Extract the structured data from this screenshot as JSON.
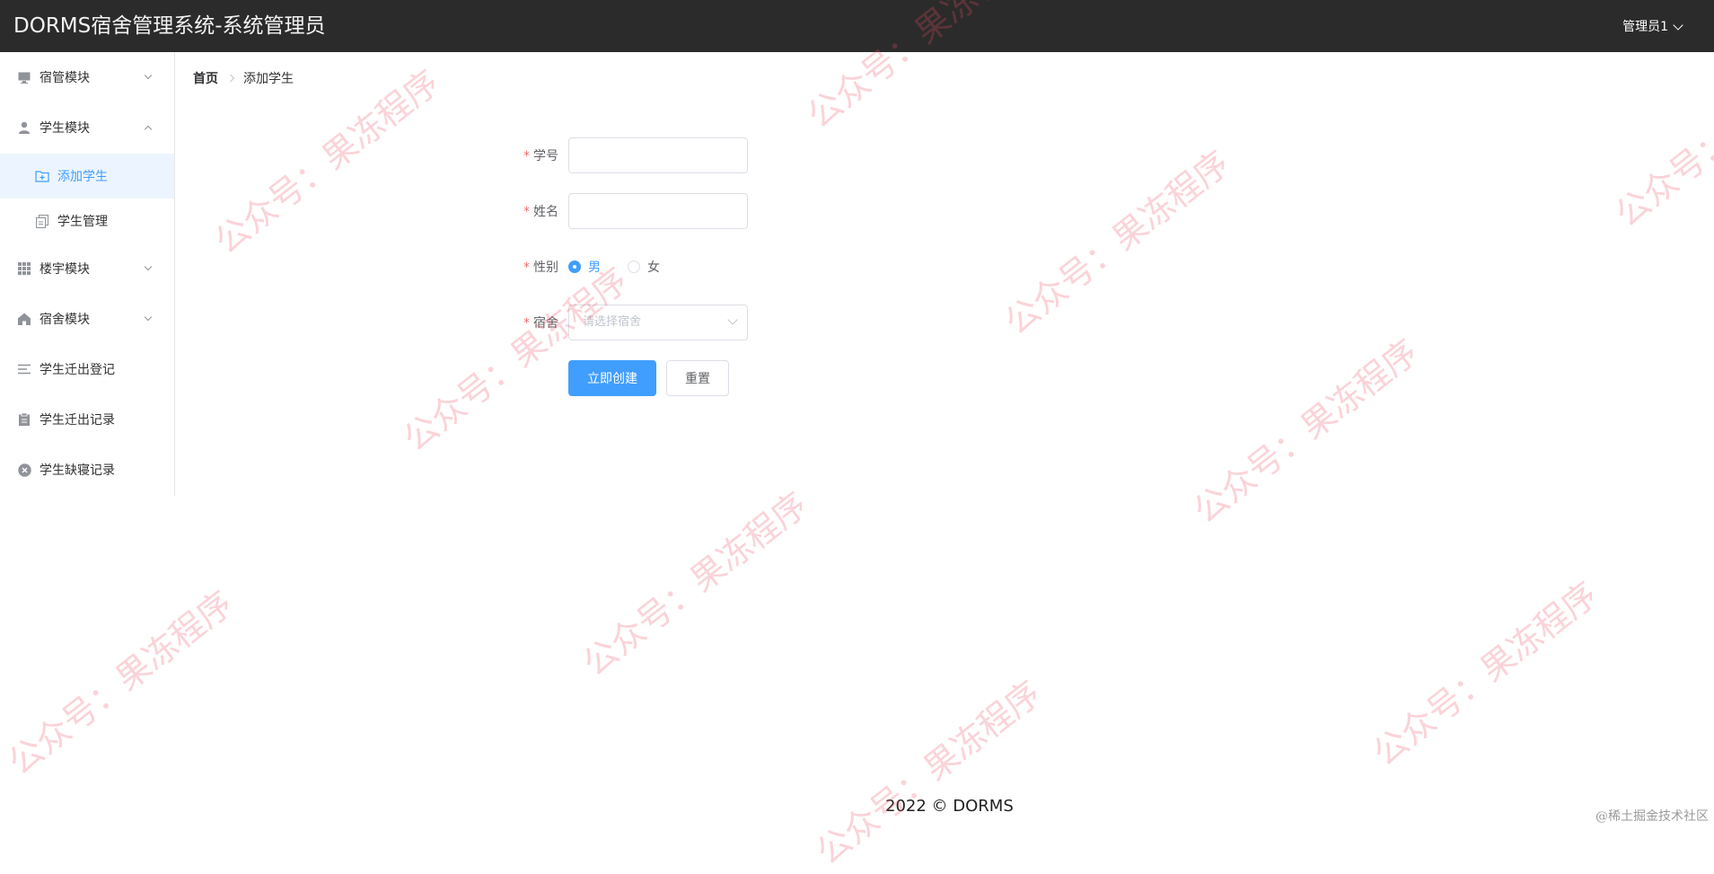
{
  "header": {
    "app_title": "DORMS宿舍管理系统-系统管理员",
    "user_name": "管理员1"
  },
  "sidebar": {
    "items": [
      {
        "label": "宿管模块",
        "icon": "monitor-icon",
        "expanded": false
      },
      {
        "label": "学生模块",
        "icon": "user-icon",
        "expanded": true,
        "children": [
          {
            "label": "添加学生",
            "icon": "folder-add-icon",
            "active": true
          },
          {
            "label": "学生管理",
            "icon": "document-copy-icon",
            "active": false
          }
        ]
      },
      {
        "label": "楼宇模块",
        "icon": "grid-icon",
        "expanded": false
      },
      {
        "label": "宿舍模块",
        "icon": "house-icon",
        "expanded": false
      },
      {
        "label": "学生迁出登记",
        "icon": "list-icon"
      },
      {
        "label": "学生迁出记录",
        "icon": "clipboard-icon"
      },
      {
        "label": "学生缺寝记录",
        "icon": "circle-close-icon"
      }
    ]
  },
  "breadcrumb": {
    "home": "首页",
    "current": "添加学生"
  },
  "form": {
    "required_mark": "*",
    "student_id": {
      "label": "学号",
      "value": ""
    },
    "name": {
      "label": "姓名",
      "value": ""
    },
    "gender": {
      "label": "性别",
      "options": [
        "男",
        "女"
      ],
      "selected": "男"
    },
    "dorm": {
      "label": "宿舍",
      "placeholder": "请选择宿舍"
    },
    "submit_label": "立即创建",
    "reset_label": "重置"
  },
  "footer": {
    "text": "2022 © DORMS"
  },
  "watermark": {
    "text": "公众号：果冻程序",
    "corner_text": "@稀土掘金技术社区"
  },
  "colors": {
    "header_bg": "#2b2b2b",
    "accent": "#409eff",
    "active_bg": "#ecf5ff",
    "required": "#f56c6c"
  }
}
